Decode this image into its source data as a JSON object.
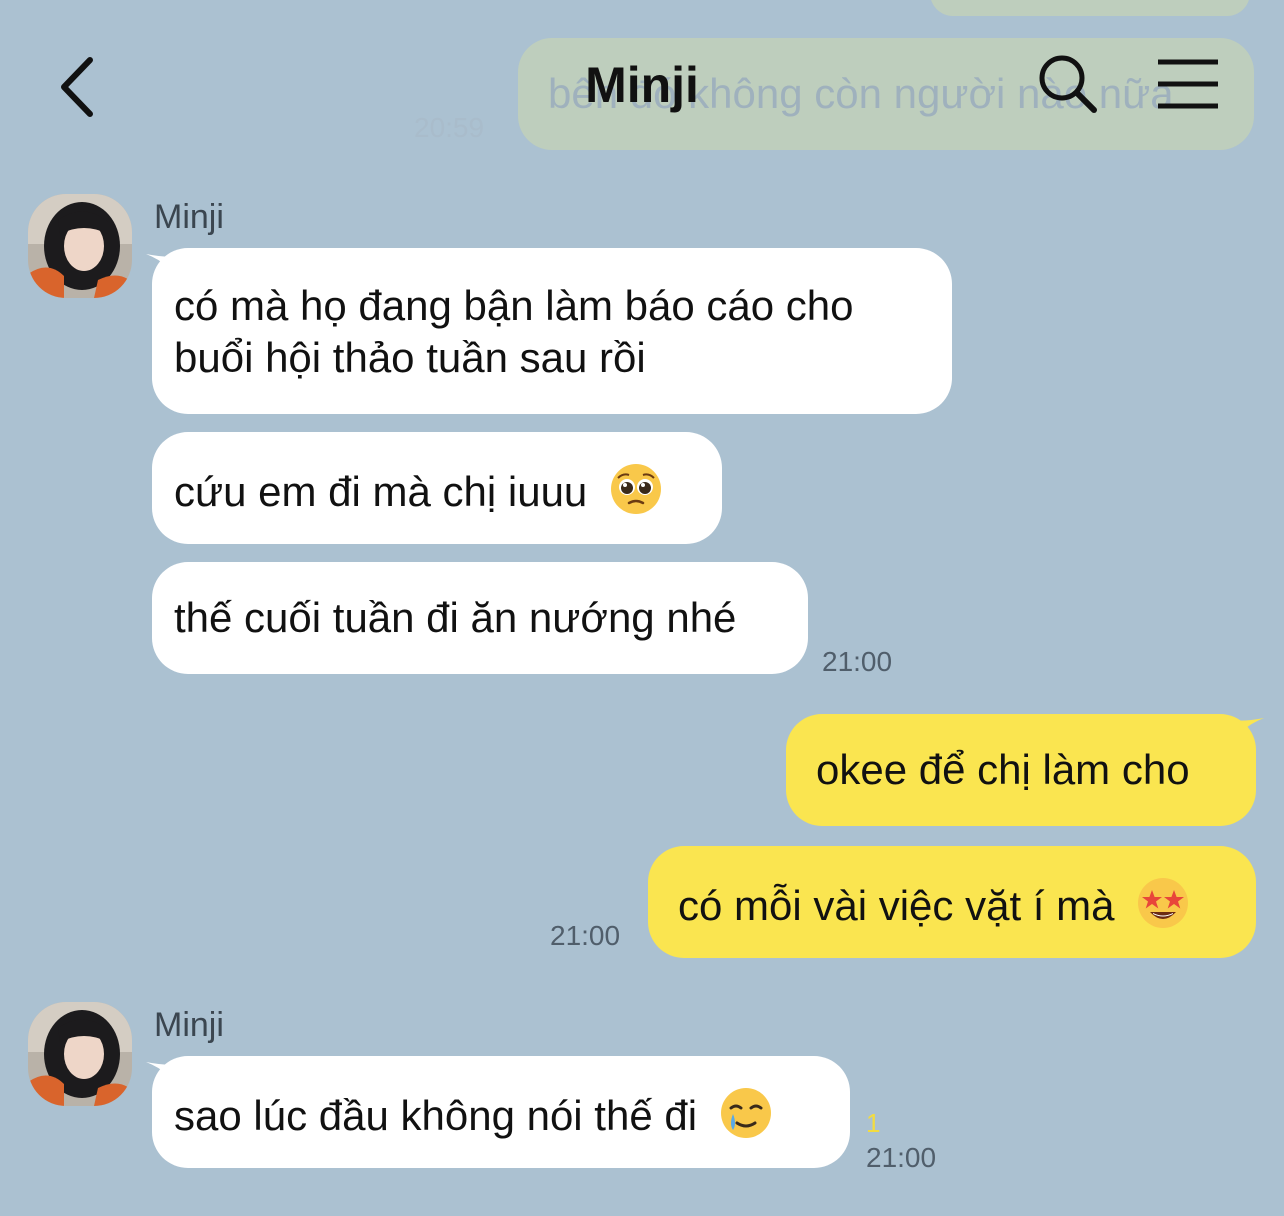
{
  "header": {
    "title": "Minji",
    "back_icon": "chevron-left-icon",
    "search_icon": "search-icon",
    "menu_icon": "menu-icon"
  },
  "faded": {
    "bubble_text": "bên đó không còn người nào nữa",
    "time": "20:59"
  },
  "groups": [
    {
      "sender": "Minji",
      "messages": [
        "có mà họ đang bận làm báo cáo cho\nbuổi hội thảo tuần sau rồi",
        "cứu em đi mà chị iuuu",
        "thế cuối tuần đi ăn nướng nhé"
      ],
      "emoji": "pleading-face-emoji",
      "time": "21:00"
    },
    {
      "sender": "me",
      "messages": [
        "okee để chị làm cho",
        "có mỗi vài việc vặt í mà"
      ],
      "emoji": "star-struck-emoji",
      "time": "21:00"
    },
    {
      "sender": "Minji",
      "messages": [
        "sao lúc đầu không nói thế đi"
      ],
      "emoji": "smiling-tear-emoji",
      "unread": "1",
      "time": "21:00"
    }
  ],
  "colors": {
    "background": "#abc1d1",
    "incoming_bubble": "#ffffff",
    "outgoing_bubble": "#fae550",
    "unread": "#f3dc40"
  }
}
